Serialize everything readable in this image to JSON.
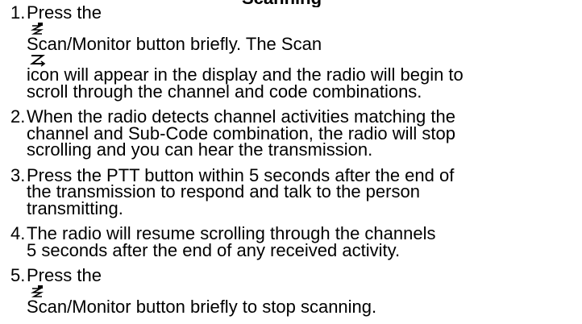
{
  "heading": "Scanning",
  "steps": [
    {
      "number": "1.",
      "icon": "scan-monitor-icon",
      "lines": [
        "Press the",
        "Scan/Monitor button briefly. The Scan",
        "icon will appear in the display and the radio will begin to",
        "scroll through the channel and code combinations."
      ]
    },
    {
      "number": "2.",
      "lines": [
        "When the radio detects channel activities matching the",
        "channel and Sub-Code combination, the radio will stop",
        "scrolling and you can hear the transmission."
      ]
    },
    {
      "number": "3.",
      "lines": [
        "Press the PTT button within 5 seconds after the end of",
        "the transmission to respond and talk to the person",
        "transmitting."
      ]
    },
    {
      "number": "4.",
      "lines": [
        "The radio will resume scrolling through the channels",
        "5 seconds after the end of any received activity."
      ]
    },
    {
      "number": "5.",
      "icon": "scan-monitor-icon",
      "lines": [
        "Press the",
        "Scan/Monitor button briefly to stop scanning."
      ]
    }
  ]
}
